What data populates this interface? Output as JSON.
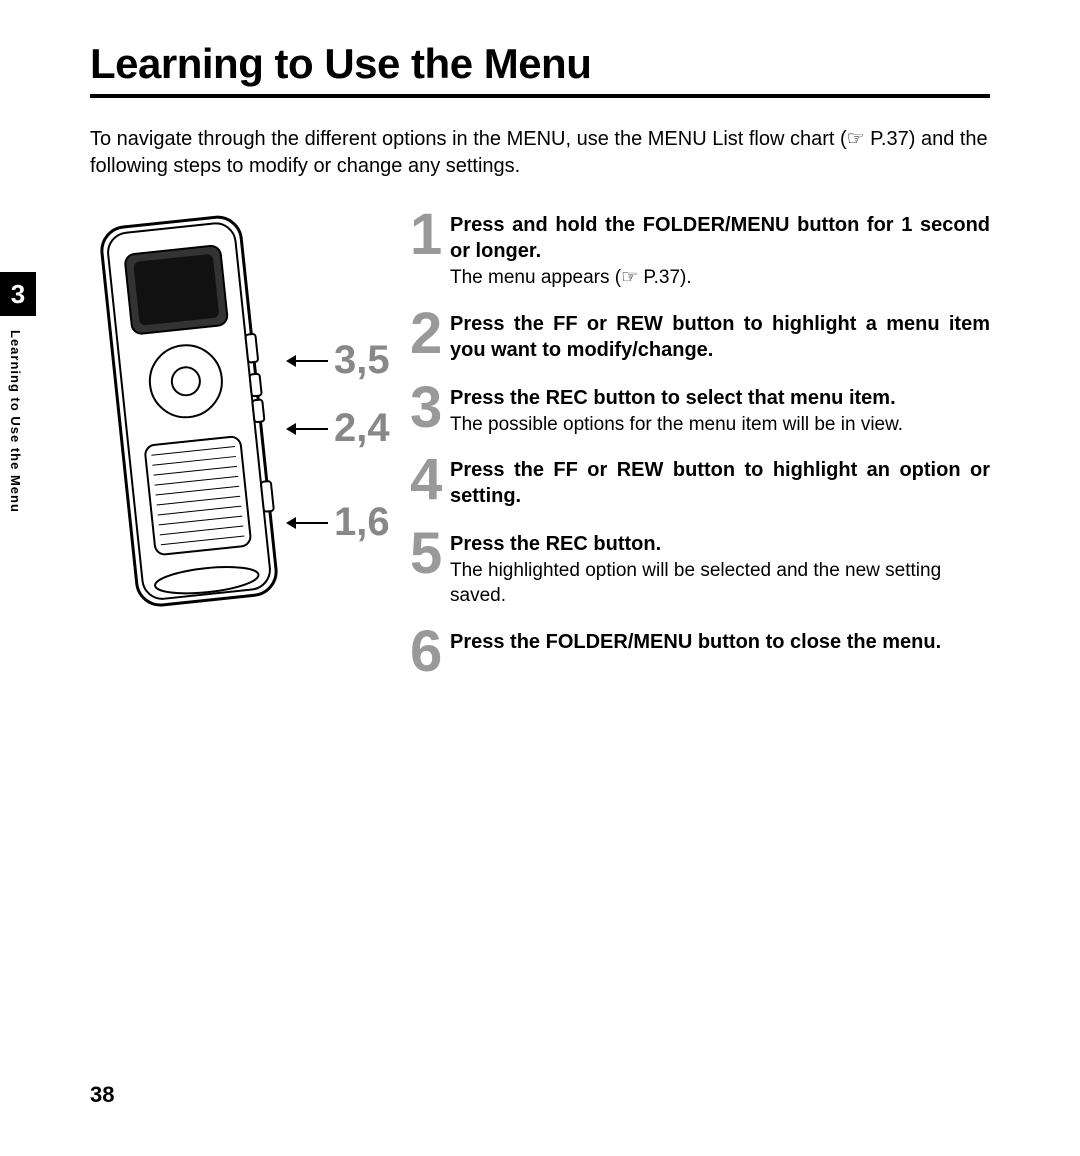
{
  "title": "Learning to Use the Menu",
  "intro": "To navigate through the different options in the MENU, use the MENU List flow chart (☞ P.37) and the following steps to modify or change any settings.",
  "chapter_tab": "3",
  "side_label": "Learning to Use the Menu",
  "page_number": "38",
  "callouts": {
    "c1": "3,5",
    "c2": "2,4",
    "c3": "1,6"
  },
  "steps": [
    {
      "num": "1",
      "title_html": "Press and hold the <b>FOLDER/MENU</b> button for 1 second or longer.",
      "desc": "The menu appears (☞ P.37)."
    },
    {
      "num": "2",
      "title_html": "Press the <b>FF</b> or <b>REW</b> button to highlight a menu item you want to modify/change.",
      "desc": ""
    },
    {
      "num": "3",
      "title_html": "Press the <b>REC</b> button to select that menu item.",
      "desc": "The possible options for the menu item will be in view."
    },
    {
      "num": "4",
      "title_html": "Press the <b>FF</b> or <b>REW</b> button to highlight an option or setting.",
      "desc": ""
    },
    {
      "num": "5",
      "title_html": "Press the <b>REC</b> button.",
      "desc": "The highlighted option will be selected and the new setting saved."
    },
    {
      "num": "6",
      "title_html": "Press the <b>FOLDER/MENU</b> button to close the menu.",
      "desc": ""
    }
  ]
}
